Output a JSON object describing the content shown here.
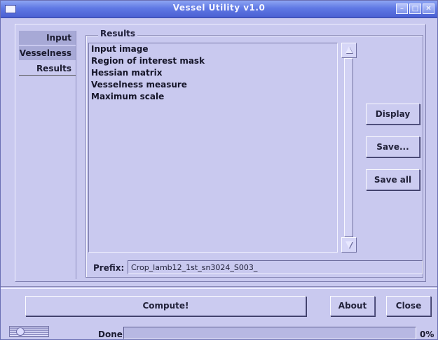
{
  "window": {
    "title": "Vessel Utility v1.0",
    "controls": {
      "minimize": "–",
      "maximize": "□",
      "close": "✕"
    }
  },
  "tabs": [
    {
      "label": "Input",
      "selected": false
    },
    {
      "label": "Vesselness",
      "selected": false
    },
    {
      "label": "Results",
      "selected": true
    }
  ],
  "results": {
    "group_title": "Results",
    "items": [
      "Input image",
      "Region of interest mask",
      "Hessian matrix",
      "Vesselness measure",
      "Maximum scale"
    ],
    "buttons": {
      "display": "Display",
      "save": "Save...",
      "save_all": "Save all"
    },
    "prefix": {
      "label": "Prefix:",
      "value": "Crop_lamb12_1st_sn3024_S003_"
    }
  },
  "actions": {
    "compute": "Compute!",
    "about": "About",
    "close": "Close"
  },
  "status": {
    "text": "Done",
    "progress_percent": 0,
    "progress_label": "0%"
  },
  "colors": {
    "window_bg": "#c9c9ef",
    "titlebar": "#5f78e4",
    "tab_inactive": "#a7a9d6"
  }
}
